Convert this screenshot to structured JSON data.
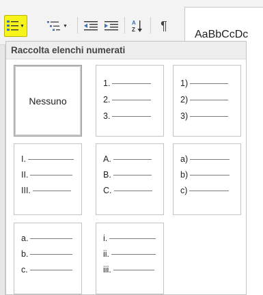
{
  "toolbar": {
    "numbering_button": {
      "icon": "numbered-list-icon",
      "highlight": "#f7f41c"
    },
    "multilevel_button": {
      "icon": "multilevel-list-icon"
    },
    "outdent_button": {
      "icon": "decrease-indent-icon"
    },
    "indent_button": {
      "icon": "increase-indent-icon"
    },
    "sort_button": {
      "icon": "sort-az-icon"
    },
    "paragraph_button": {
      "icon": "pilcrow-icon",
      "glyph": "¶"
    },
    "style_preview": "AaBbCcDc"
  },
  "gallery": {
    "title": "Raccolta elenchi numerati",
    "items": [
      {
        "label": "Nessuno",
        "markers": []
      },
      {
        "markers": [
          "1.",
          "2.",
          "3."
        ]
      },
      {
        "markers": [
          "1)",
          "2)",
          "3)"
        ]
      },
      {
        "markers": [
          "I.",
          "II.",
          "III."
        ]
      },
      {
        "markers": [
          "A.",
          "B.",
          "C."
        ]
      },
      {
        "markers": [
          "a)",
          "b)",
          "c)"
        ]
      },
      {
        "markers": [
          "a.",
          "b.",
          "c."
        ]
      },
      {
        "markers": [
          "i.",
          "ii.",
          "iii."
        ]
      }
    ]
  }
}
